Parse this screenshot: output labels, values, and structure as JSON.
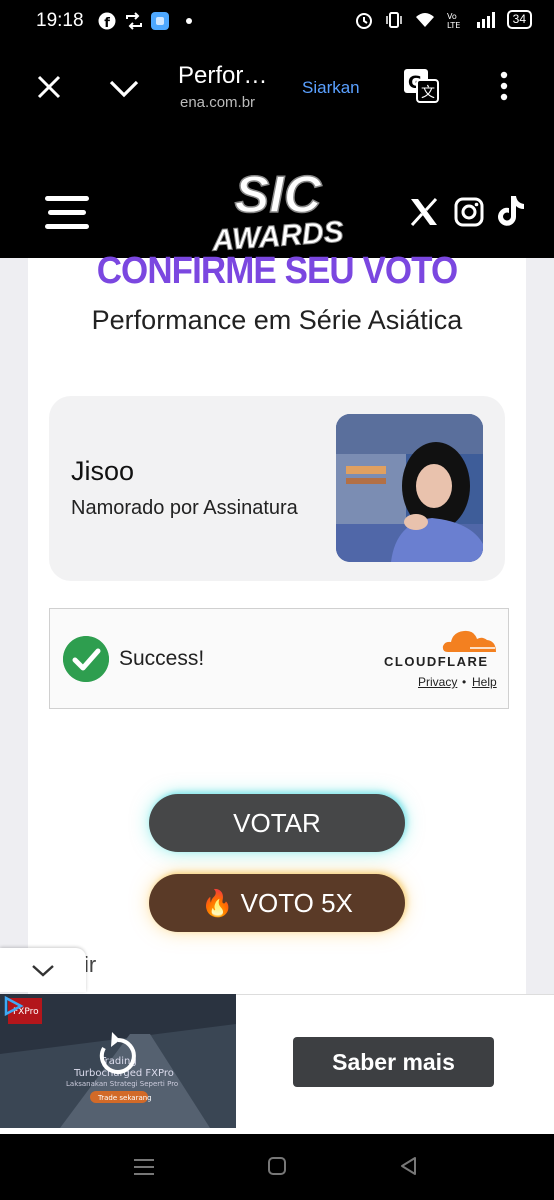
{
  "status_bar": {
    "time": "19:18",
    "battery": "34",
    "left_icons": [
      "facebook-icon",
      "retweet-icon",
      "app-icon",
      "dot-icon"
    ],
    "right_icons": [
      "alarm-icon",
      "vibrate-icon",
      "wifi-icon",
      "volte-icon",
      "signal-icon",
      "battery-icon"
    ]
  },
  "browser": {
    "title": "Perfor…",
    "domain": "ena.com.br",
    "share_label": "Siarkan",
    "link_color": "#5aa0ff"
  },
  "site": {
    "logo_line1": "SIC",
    "logo_line2": "AWARDS",
    "social_icons": [
      "x-icon",
      "instagram-icon",
      "tiktok-icon"
    ]
  },
  "vote": {
    "heading": "CONFIRME SEU VOTO",
    "heading_color": "#7b47e0",
    "category": "Performance em Série Asiática",
    "nominee": {
      "name": "Jisoo",
      "work": "Namorado por Assinatura"
    },
    "captcha": {
      "status": "Success!",
      "brand": "CLOUDFLARE",
      "privacy": "Privacy",
      "separator": "•",
      "help": "Help",
      "success_color": "#2e9e4f",
      "brand_color": "#f38020"
    },
    "vote_button": "VOTAR",
    "vote5_button": "🔥 VOTO 5X",
    "partial_text": "ir"
  },
  "ad": {
    "cta": "Saber mais",
    "image_text_1": "Trading",
    "image_text_2": "Turbocharged FXPro",
    "image_text_3": "Laksanakan Strategi Seperti Pro",
    "image_text_4": "Trade sekarang",
    "image_brand": "FXPro"
  }
}
